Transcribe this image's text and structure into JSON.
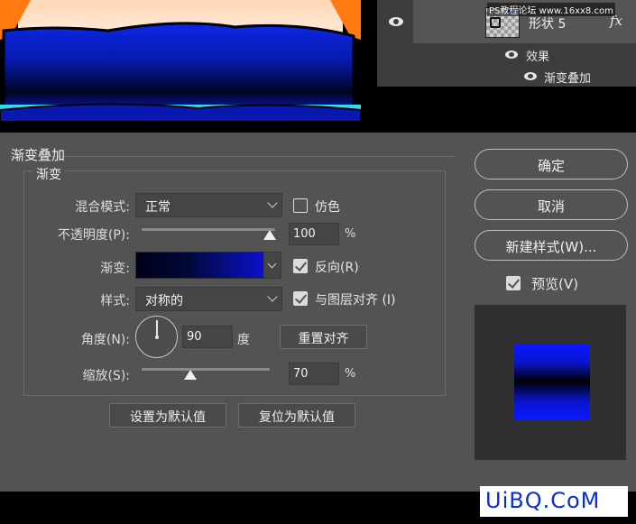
{
  "layers_panel": {
    "watermark": "PS教程论坛 www.16xx8.com",
    "layer_name": "形状 5",
    "fx_label": "fx",
    "effects_label": "效果",
    "gradient_overlay_label": "渐变叠加",
    "icons": [
      "eye-icon",
      "layer-thumbnail",
      "fx-icon"
    ]
  },
  "dialog": {
    "title": "渐变叠加",
    "group_title": "渐变",
    "blend_mode": {
      "label": "混合模式:",
      "value": "正常"
    },
    "dither": {
      "label": "仿色",
      "checked": false
    },
    "opacity": {
      "label": "不透明度(P):",
      "value": "100",
      "unit": "%",
      "level": 1.0
    },
    "gradient": {
      "label": "渐变:",
      "colors": [
        "#00001a",
        "#000836",
        "#0a10c8"
      ]
    },
    "reverse": {
      "label": "反向(R)",
      "checked": true
    },
    "style": {
      "label": "样式:",
      "value": "对称的"
    },
    "align_with_layer": {
      "label": "与图层对齐 (I)",
      "checked": true
    },
    "angle": {
      "label": "角度(N):",
      "value": "90",
      "unit": "度"
    },
    "reset_align_button": "重置对齐",
    "scale": {
      "label": "缩放(S):",
      "value": "70",
      "unit": "%",
      "level": 0.7
    },
    "make_default_button": "设置为默认值",
    "reset_default_button": "复位为默认值"
  },
  "side_buttons": {
    "ok": "确定",
    "cancel": "取消",
    "new_style": "新建样式(W)...",
    "preview": {
      "label": "预览(V)",
      "checked": true
    }
  },
  "site_logo": "UiBQ.CoM",
  "colors": {
    "dialog_bg": "#535353",
    "accent_blue": "#0a18ff",
    "canvas_orange": "#ff7a10",
    "canvas_cyan": "#38d8f0"
  }
}
